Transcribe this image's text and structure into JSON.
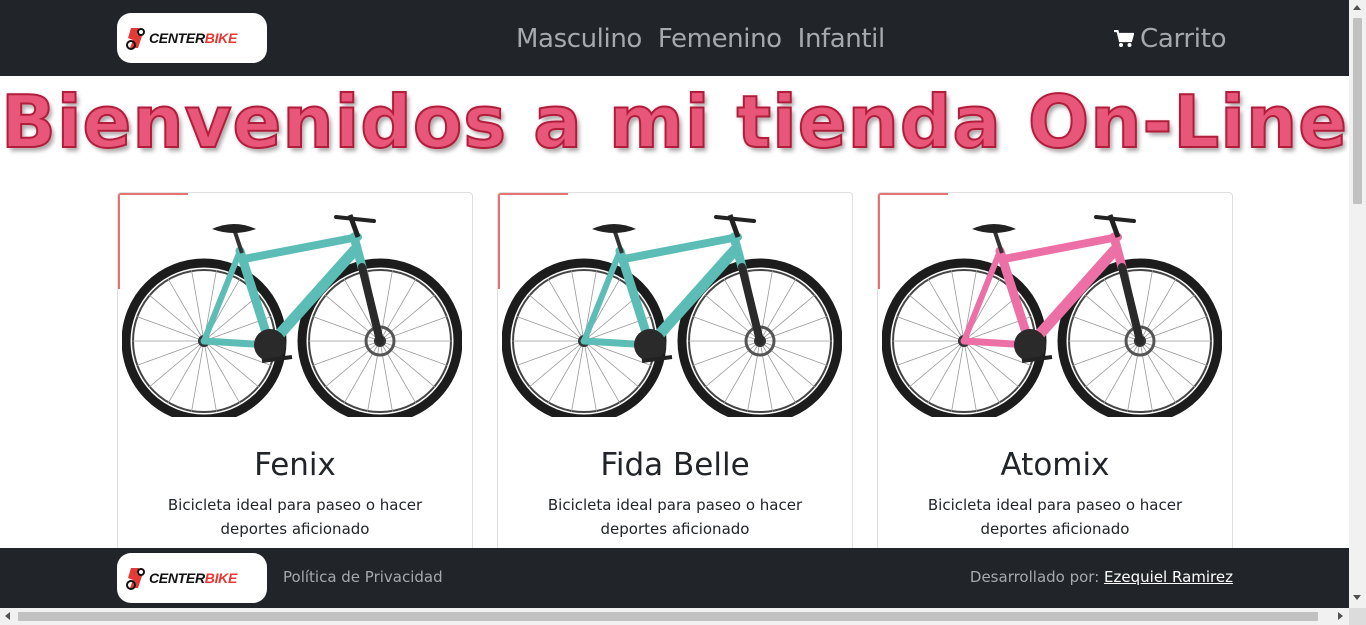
{
  "brand": {
    "logo_text_dark": "CENTER",
    "logo_text_accent": "BIKE",
    "logo_icon": "bike-logo-icon",
    "accent_color": "#e53935"
  },
  "nav": {
    "links": [
      {
        "label": "Masculino"
      },
      {
        "label": "Femenino"
      },
      {
        "label": "Infantil"
      }
    ],
    "cart_icon": "shopping-cart-icon",
    "cart_label": "Carrito"
  },
  "hero": {
    "title": "Bienvenidos a mi tienda On-Line",
    "color": "#e8577a"
  },
  "products": [
    {
      "name": "Fenix",
      "description": "Bicicleta ideal para paseo o hacer deportes aficionado",
      "frame_color": "#5bbdb5",
      "image_icon": "mountain-bike-image"
    },
    {
      "name": "Fida Belle",
      "description": "Bicicleta ideal para paseo o hacer deportes aficionado",
      "frame_color": "#5bbdb5",
      "image_icon": "mountain-bike-image"
    },
    {
      "name": "Atomix",
      "description": "Bicicleta ideal para paseo o hacer deportes aficionado",
      "frame_color": "#ec6fa6",
      "image_icon": "mountain-bike-image"
    }
  ],
  "footer": {
    "privacy_label": "Política de Privacidad",
    "credit_prefix": "Desarrollado por:",
    "credit_name": "Ezequiel Ramirez"
  }
}
